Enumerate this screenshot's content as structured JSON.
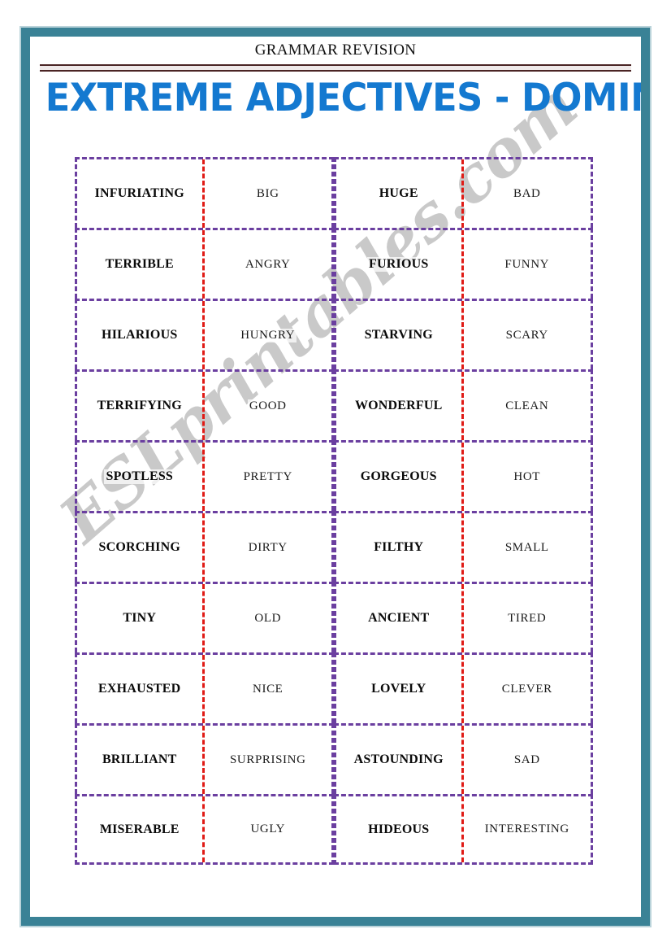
{
  "page": {
    "subtitle": "GRAMMAR REVISION",
    "title": "EXTREME ADJECTIVES - DOMINO",
    "watermark": "ESLprintables.com",
    "frame_color": "#3a8296",
    "title_color": "#1479d0",
    "rule_color": "#4a2424",
    "cell_border_color": "#6b3fa0",
    "divider_color": "#e01b16",
    "watermark_color": "#c9c9c9"
  },
  "grid": {
    "rows": [
      {
        "left_domino": {
          "extreme": "INFURIATING",
          "normal": "BIG"
        },
        "right_domino": {
          "extreme": "HUGE",
          "normal": "BAD"
        }
      },
      {
        "left_domino": {
          "extreme": "TERRIBLE",
          "normal": "ANGRY"
        },
        "right_domino": {
          "extreme": "FURIOUS",
          "normal": "FUNNY"
        }
      },
      {
        "left_domino": {
          "extreme": "HILARIOUS",
          "normal": "HUNGRY"
        },
        "right_domino": {
          "extreme": "STARVING",
          "normal": "SCARY"
        }
      },
      {
        "left_domino": {
          "extreme": "TERRIFYING",
          "normal": "GOOD"
        },
        "right_domino": {
          "extreme": "WONDERFUL",
          "normal": "CLEAN"
        }
      },
      {
        "left_domino": {
          "extreme": "SPOTLESS",
          "normal": "PRETTY"
        },
        "right_domino": {
          "extreme": "GORGEOUS",
          "normal": "HOT"
        }
      },
      {
        "left_domino": {
          "extreme": "SCORCHING",
          "normal": "DIRTY"
        },
        "right_domino": {
          "extreme": "FILTHY",
          "normal": "SMALL"
        }
      },
      {
        "left_domino": {
          "extreme": "TINY",
          "normal": "OLD"
        },
        "right_domino": {
          "extreme": "ANCIENT",
          "normal": "TIRED"
        }
      },
      {
        "left_domino": {
          "extreme": "EXHAUSTED",
          "normal": "NICE"
        },
        "right_domino": {
          "extreme": "LOVELY",
          "normal": "CLEVER"
        }
      },
      {
        "left_domino": {
          "extreme": "BRILLIANT",
          "normal": "SURPRISING"
        },
        "right_domino": {
          "extreme": "ASTOUNDING",
          "normal": "SAD"
        }
      },
      {
        "left_domino": {
          "extreme": "MISERABLE",
          "normal": "UGLY"
        },
        "right_domino": {
          "extreme": "HIDEOUS",
          "normal": "INTERESTING"
        }
      }
    ]
  }
}
